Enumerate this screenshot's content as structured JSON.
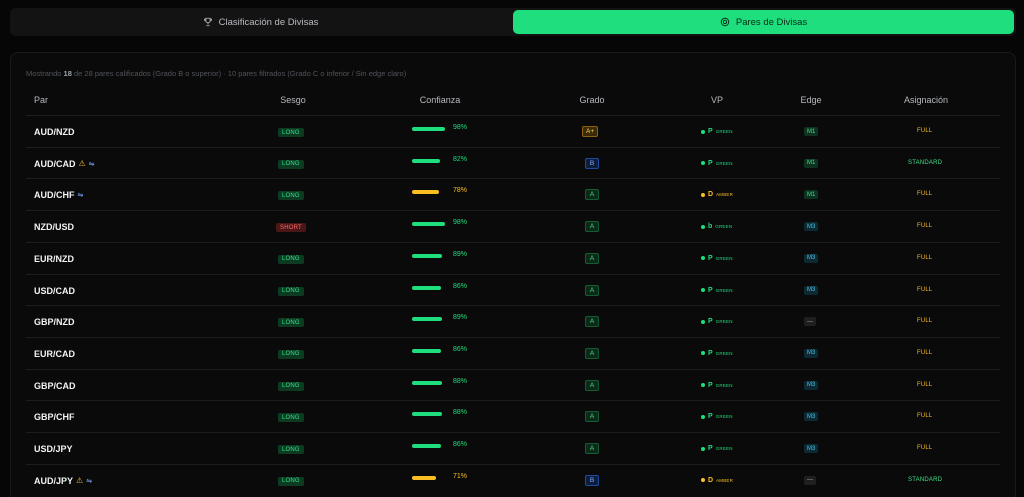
{
  "tabs": [
    {
      "label": "Clasificación de Divisas",
      "icon": "trophy-icon",
      "active": false
    },
    {
      "label": "Pares de Divisas",
      "icon": "target-icon",
      "active": true
    }
  ],
  "summary": {
    "prefix": "Mostrando",
    "shown": "18",
    "middle": "de 28 pares calificados (Grado B o superior) · 10 pares filtrados (Grado C o inferior / Sin edge claro)"
  },
  "columns": [
    "Par",
    "Sesgo",
    "Confianza",
    "Grado",
    "VP",
    "Edge",
    "Asignación"
  ],
  "colors": {
    "green": "#1fde7e",
    "amber": "#fbbf24",
    "red": "#ff6b6b",
    "cyan": "#4fc3e8"
  },
  "rows": [
    {
      "pair": "AUD/NZD",
      "warn": "",
      "flow": "",
      "bias": "LONG",
      "conf_value": 98,
      "conf": "98%",
      "grade": "A+",
      "vp_letter": "P",
      "vp_status": "GREEN",
      "edge": "M1",
      "alloc": "FULL"
    },
    {
      "pair": "AUD/CAD",
      "warn": "⚠",
      "flow": "⇋",
      "bias": "LONG",
      "conf_value": 82,
      "conf": "82%",
      "grade": "B",
      "vp_letter": "P",
      "vp_status": "GREEN",
      "edge": "M1",
      "alloc": "STANDARD"
    },
    {
      "pair": "AUD/CHF",
      "warn": "",
      "flow": "⇋",
      "bias": "LONG",
      "conf_value": 78,
      "conf": "78%",
      "grade": "A",
      "vp_letter": "D",
      "vp_status": "AMBER",
      "edge": "M1",
      "alloc": "FULL"
    },
    {
      "pair": "NZD/USD",
      "warn": "",
      "flow": "",
      "bias": "SHORT",
      "conf_value": 98,
      "conf": "98%",
      "grade": "A",
      "vp_letter": "b",
      "vp_status": "GREEN",
      "edge": "M3",
      "alloc": "FULL"
    },
    {
      "pair": "EUR/NZD",
      "warn": "",
      "flow": "",
      "bias": "LONG",
      "conf_value": 89,
      "conf": "89%",
      "grade": "A",
      "vp_letter": "P",
      "vp_status": "GREEN",
      "edge": "M3",
      "alloc": "FULL"
    },
    {
      "pair": "USD/CAD",
      "warn": "",
      "flow": "",
      "bias": "LONG",
      "conf_value": 86,
      "conf": "86%",
      "grade": "A",
      "vp_letter": "P",
      "vp_status": "GREEN",
      "edge": "M3",
      "alloc": "FULL"
    },
    {
      "pair": "GBP/NZD",
      "warn": "",
      "flow": "",
      "bias": "LONG",
      "conf_value": 89,
      "conf": "89%",
      "grade": "A",
      "vp_letter": "P",
      "vp_status": "GREEN",
      "edge": "—",
      "alloc": "FULL"
    },
    {
      "pair": "EUR/CAD",
      "warn": "",
      "flow": "",
      "bias": "LONG",
      "conf_value": 86,
      "conf": "86%",
      "grade": "A",
      "vp_letter": "P",
      "vp_status": "GREEN",
      "edge": "M3",
      "alloc": "FULL"
    },
    {
      "pair": "GBP/CAD",
      "warn": "",
      "flow": "",
      "bias": "LONG",
      "conf_value": 88,
      "conf": "88%",
      "grade": "A",
      "vp_letter": "P",
      "vp_status": "GREEN",
      "edge": "M3",
      "alloc": "FULL"
    },
    {
      "pair": "GBP/CHF",
      "warn": "",
      "flow": "",
      "bias": "LONG",
      "conf_value": 88,
      "conf": "88%",
      "grade": "A",
      "vp_letter": "P",
      "vp_status": "GREEN",
      "edge": "M3",
      "alloc": "FULL"
    },
    {
      "pair": "USD/JPY",
      "warn": "",
      "flow": "",
      "bias": "LONG",
      "conf_value": 86,
      "conf": "86%",
      "grade": "A",
      "vp_letter": "P",
      "vp_status": "GREEN",
      "edge": "M3",
      "alloc": "FULL"
    },
    {
      "pair": "AUD/JPY",
      "warn": "⚠",
      "flow": "⇋",
      "bias": "LONG",
      "conf_value": 71,
      "conf": "71%",
      "grade": "B",
      "vp_letter": "D",
      "vp_status": "AMBER",
      "edge": "—",
      "alloc": "STANDARD"
    }
  ]
}
